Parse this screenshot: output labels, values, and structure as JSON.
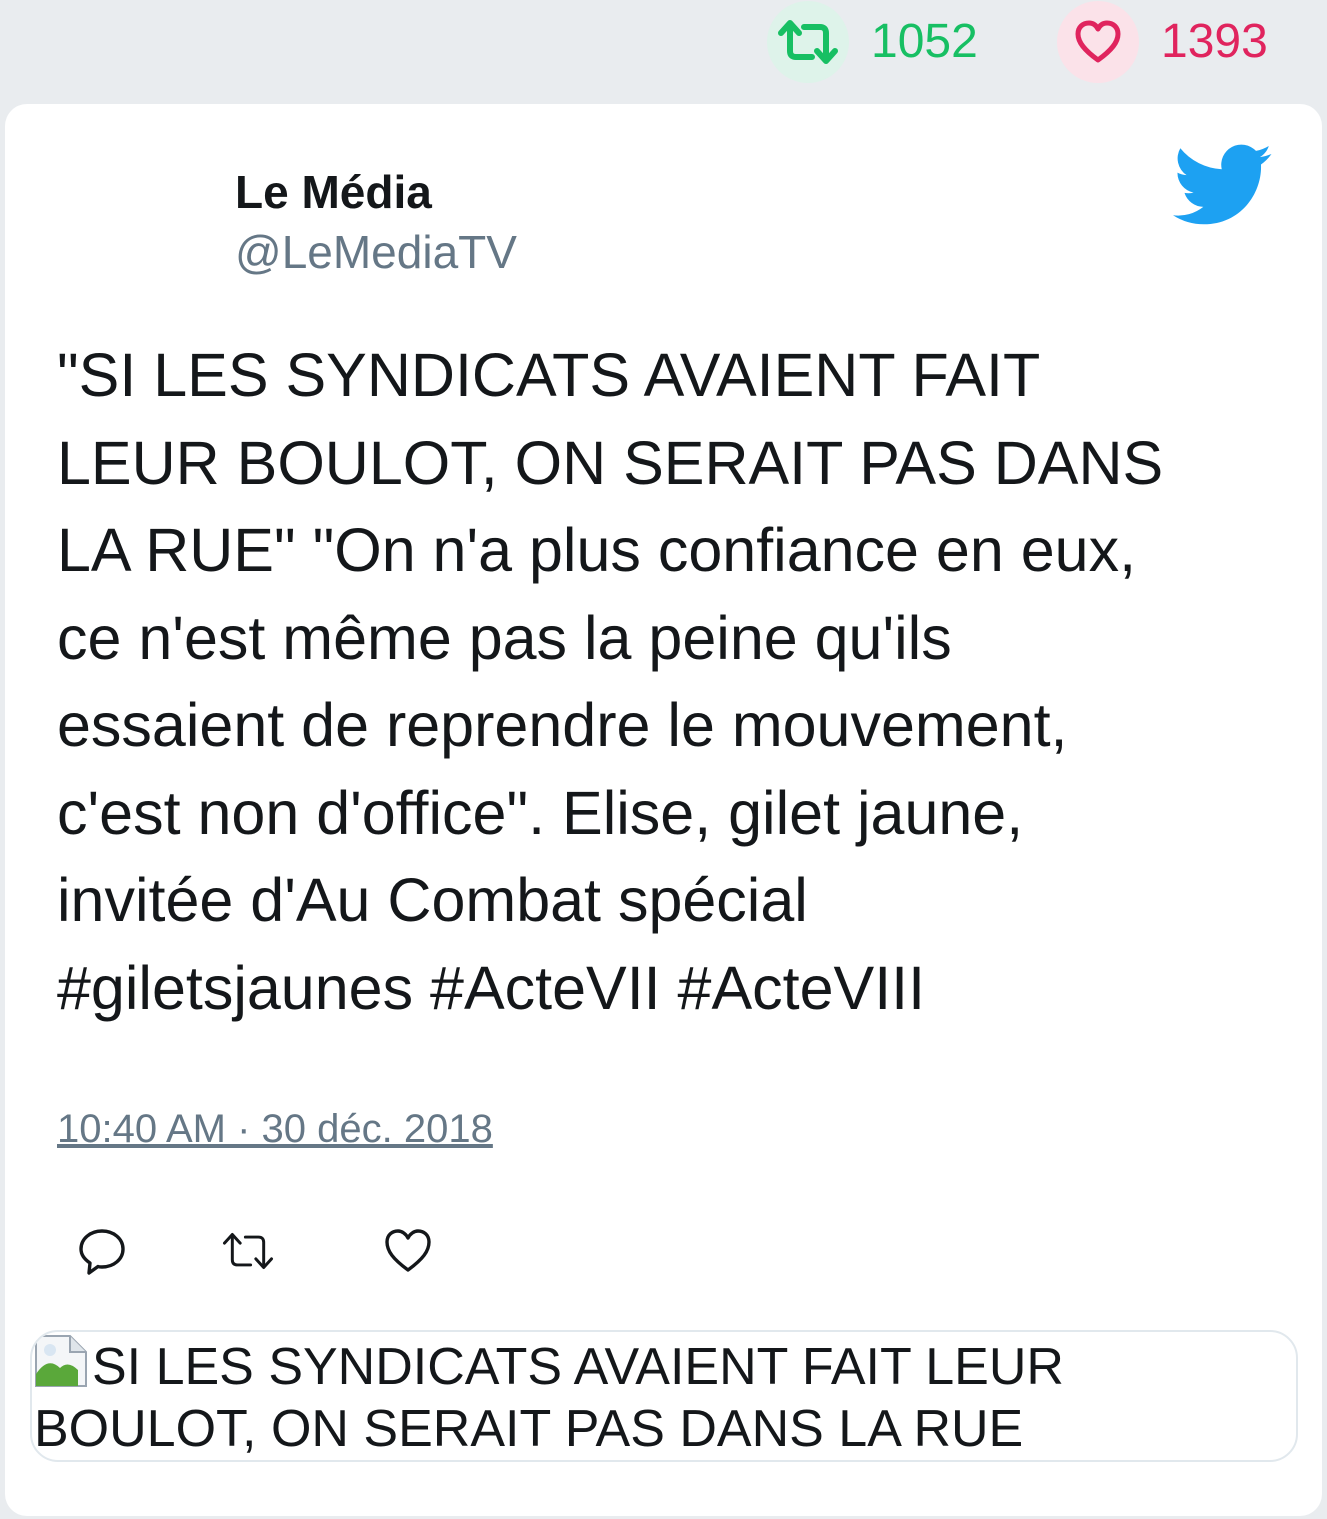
{
  "stats": {
    "retweets": "1052",
    "likes": "1393"
  },
  "author": {
    "name": "Le Média",
    "handle": "@LeMediaTV"
  },
  "tweet": {
    "text": "\"SI LES SYNDICATS AVAIENT FAIT\nLEUR BOULOT, ON SERAIT PAS DANS\nLA RUE\" \"On n'a plus confiance en eux,\nce n'est même pas la peine qu'ils\nessaient de reprendre le mouvement,\nc'est non d'office\". Elise, gilet jaune,\ninvitée d'Au Combat spécial\n#giletsjaunes #ActeVII #ActeVIII",
    "timestamp": "10:40 AM · 30 déc. 2018"
  },
  "link_preview": {
    "alt_text": "SI LES SYNDICATS AVAIENT FAIT LEUR BOULOT, ON SERAIT PAS DANS LA RUE"
  },
  "icons": {
    "retweet": "retweet-icon",
    "like": "heart-icon",
    "brand": "twitter-bird-icon",
    "reply": "reply-icon",
    "broken_image": "broken-image-icon"
  },
  "colors": {
    "retweet_green": "#17bf63",
    "like_red": "#e0245e",
    "twitter_blue": "#1da1f2",
    "secondary_text": "#657786"
  }
}
